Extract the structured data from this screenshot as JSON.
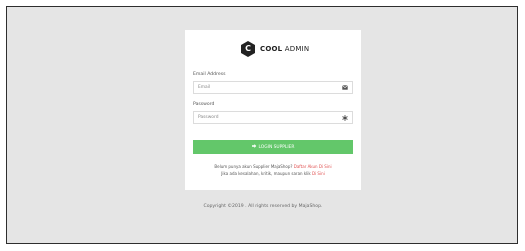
{
  "brand": {
    "logo_letter": "C",
    "name_bold": "COOL",
    "name_light": "ADMIN"
  },
  "form": {
    "email_label": "Email Address",
    "email_placeholder": "Email",
    "password_label": "Password",
    "password_placeholder": "Password",
    "login_button": "LOGIN SUPPLIER"
  },
  "info": {
    "line1_text": "Belum punya akun Supplier MajaShop?",
    "line1_link": "Daftar Akun Di Sini",
    "line2_text": "Jika ada kesalahan, kritik, maupun saran klik",
    "line2_link": "Di Sini"
  },
  "footer": {
    "copyright": "Copyright ©2019 . All rights reserved by MajaShop."
  },
  "colors": {
    "accent_green": "#63c76a",
    "link_red": "#e05050",
    "background": "#e5e5e5"
  },
  "icons": {
    "email_addon": "envelope-icon",
    "password_addon": "asterisk-icon",
    "button_icon": "sign-in-icon"
  }
}
